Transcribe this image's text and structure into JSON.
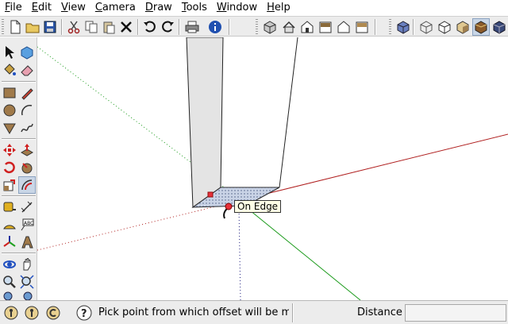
{
  "menubar": {
    "items": [
      {
        "u": "F",
        "rest": "ile"
      },
      {
        "u": "E",
        "rest": "dit"
      },
      {
        "u": "V",
        "rest": "iew"
      },
      {
        "u": "C",
        "rest": "amera"
      },
      {
        "u": "D",
        "rest": "raw"
      },
      {
        "u": "T",
        "rest": "ools"
      },
      {
        "u": "W",
        "rest": "indow"
      },
      {
        "u": "H",
        "rest": "elp"
      }
    ]
  },
  "viewport": {
    "inference_tooltip": "On Edge",
    "colors": {
      "red_axis": "#b02020",
      "green_axis": "#1a9a1a",
      "blue_axis": "#202080",
      "face_gray": "#e4e4e4",
      "selected_face": "#c9d3e6",
      "endpoint_marker": "#e8303a"
    }
  },
  "statusbar": {
    "hint": "Pick point from which offset will be measured.",
    "vcb_label": "Distance",
    "vcb_value": ""
  }
}
